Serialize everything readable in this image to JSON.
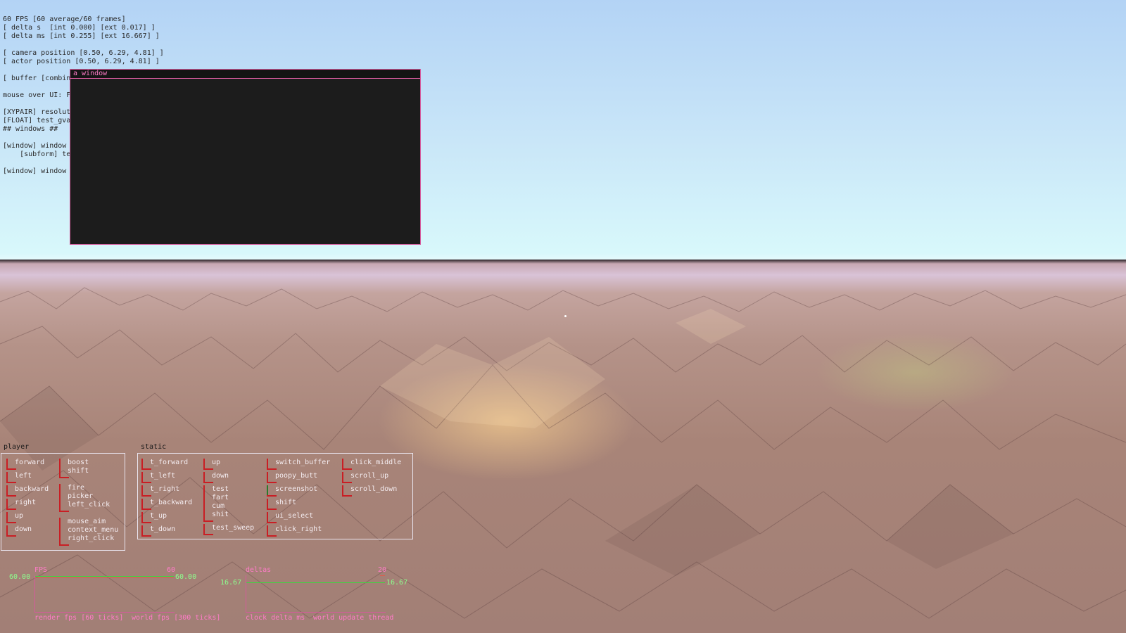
{
  "debug_lines": [
    "60 FPS [60 average/60 frames]",
    "[ delta s  [int 0.000] [ext 0.017] ]",
    "[ delta ms [int 0.255] [ext 16.667] ]",
    "",
    "[ camera position [0.50, 6.29, 4.81] ]",
    "[ actor position [0.50, 6.29, 4.81] ]",
    "",
    "[ buffer [combin",
    "",
    "mouse over UI: F",
    "",
    "[XYPAIR] resolut",
    "[FLOAT] test_gva",
    "## windows ##",
    "",
    "[window] window",
    "    [subform] te",
    "",
    "[window] window"
  ],
  "window": {
    "title": "a window"
  },
  "player": {
    "label": "player",
    "col1": [
      "forward",
      "left",
      "backward",
      "right",
      "up",
      "down"
    ],
    "col2": [
      {
        "lines": [
          "boost",
          "shift"
        ]
      },
      {
        "lines": [
          "fire",
          "picker",
          "left_click"
        ]
      },
      {
        "lines": [
          "mouse_aim",
          "context_menu",
          "right_click"
        ]
      }
    ]
  },
  "static": {
    "label": "static",
    "col1": [
      "t_forward",
      "t_left",
      "t_right",
      "t_backward",
      "t_up",
      "t_down"
    ],
    "col2": [
      {
        "lines": [
          "up"
        ]
      },
      {
        "lines": [
          "down"
        ]
      },
      {
        "lines": [
          "test",
          "fart",
          "cum",
          "shit"
        ]
      },
      {
        "lines": [
          "test_sweep"
        ]
      }
    ],
    "col3": [
      "switch_buffer",
      "poopy_butt",
      "screenshot",
      "shift",
      "ui_select",
      "click_right"
    ],
    "col4": [
      "click_middle",
      "scroll_up",
      "scroll_down"
    ]
  },
  "graphs": {
    "fps": {
      "title": "FPS",
      "max": "60",
      "left_value": "60.00",
      "right_value": "60.00",
      "foot_a": "render fps [60 ticks]",
      "foot_b": "world fps [300 ticks]"
    },
    "deltas": {
      "title": "deltas",
      "max": "20",
      "left_value": "16.67",
      "right_value": "16.67",
      "foot_a": "clock delta ms",
      "foot_b": "world update thread"
    }
  }
}
